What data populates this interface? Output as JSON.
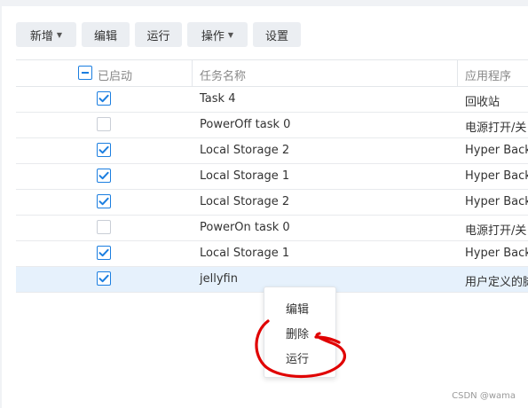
{
  "toolbar": {
    "new_label": "新增",
    "edit_label": "编辑",
    "run_label": "运行",
    "actions_label": "操作",
    "settings_label": "设置"
  },
  "table": {
    "columns": [
      "已启动",
      "任务名称",
      "应用程序"
    ],
    "rows": [
      {
        "enabled": true,
        "name": "Task 4",
        "app": "回收站"
      },
      {
        "enabled": false,
        "name": "PowerOff task 0",
        "app": "电源打开/关"
      },
      {
        "enabled": true,
        "name": "Local Storage 2",
        "app": "Hyper Back"
      },
      {
        "enabled": true,
        "name": "Local Storage 1",
        "app": "Hyper Back"
      },
      {
        "enabled": true,
        "name": "Local Storage 2",
        "app": "Hyper Back"
      },
      {
        "enabled": false,
        "name": "PowerOn task 0",
        "app": "电源打开/关"
      },
      {
        "enabled": true,
        "name": "Local Storage 1",
        "app": "Hyper Back"
      },
      {
        "enabled": true,
        "name": "jellyfin",
        "app": "用户定义的脚",
        "selected": true
      }
    ]
  },
  "context_menu": {
    "items": [
      "编辑",
      "删除",
      "运行"
    ]
  },
  "watermark": "CSDN @wama",
  "colors": {
    "accent": "#1b7ee0",
    "selected_row": "#e6f1fc",
    "annotation": "#e00000"
  }
}
